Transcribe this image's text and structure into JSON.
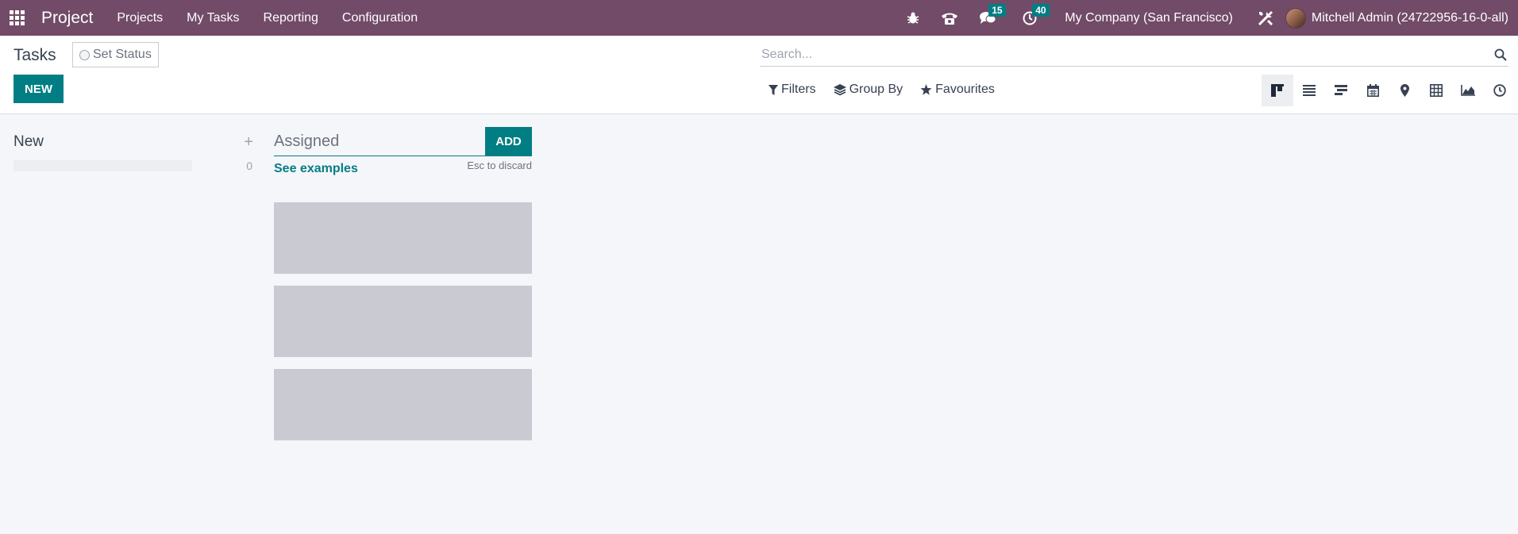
{
  "navbar": {
    "app_name": "Project",
    "menu": [
      "Projects",
      "My Tasks",
      "Reporting",
      "Configuration"
    ],
    "messages_count": "15",
    "activities_count": "40",
    "company": "My Company (San Francisco)",
    "user": "Mitchell Admin (24722956-16-0-all)",
    "bg_color": "#714b67"
  },
  "control": {
    "title": "Tasks",
    "set_status": "Set Status",
    "new_label": "NEW",
    "search_placeholder": "Search...",
    "filters_label": "Filters",
    "group_by_label": "Group By",
    "favourites_label": "Favourites",
    "views": [
      "kanban-view-icon",
      "list-view-icon",
      "gantt-view-icon",
      "calendar-view-icon",
      "map-view-icon",
      "pivot-view-icon",
      "graph-view-icon",
      "activity-view-icon"
    ]
  },
  "kanban": {
    "column": {
      "title": "New",
      "count": "0"
    },
    "quick_create": {
      "value": "Assigned",
      "add_label": "ADD",
      "examples_label": "See examples",
      "esc_hint": "Esc to discard"
    }
  },
  "colors": {
    "accent": "#017e84",
    "ghost": "#c9cad2"
  }
}
